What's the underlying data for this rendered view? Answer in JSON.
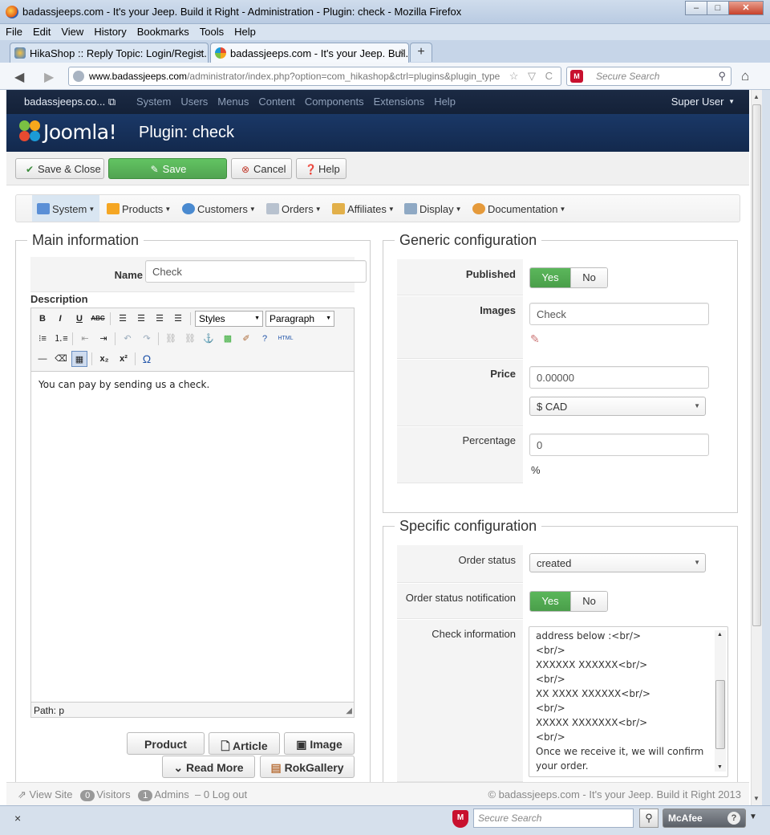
{
  "window": {
    "title": "badassjeeps.com - It's your Jeep. Build it Right - Administration - Plugin: check - Mozilla Firefox",
    "min": "‒",
    "max": "□",
    "close": "✕"
  },
  "browser_menu": [
    "File",
    "Edit",
    "View",
    "History",
    "Bookmarks",
    "Tools",
    "Help"
  ],
  "tabs": [
    {
      "label": "HikaShop :: Reply Topic: Login/Regist...",
      "close": "×"
    },
    {
      "label": "badassjeeps.com - It's your Jeep. Buil...",
      "close": "×"
    }
  ],
  "new_tab": "+",
  "urlbar": {
    "domain": "www.badassjeeps.com",
    "path": "/administrator/index.php?option=com_hikashop&ctrl=plugins&plugin_type",
    "icons": "☆ ▽ C"
  },
  "search": {
    "placeholder": "Secure Search"
  },
  "joomla": {
    "site": "badassjeeps.co...",
    "menu": [
      "System",
      "Users",
      "Menus",
      "Content",
      "Components",
      "Extensions",
      "Help"
    ],
    "user": "Super User",
    "brand": "Joomla!",
    "page_title": "Plugin: check"
  },
  "toolbar": {
    "save_close": "Save & Close",
    "save": "Save",
    "cancel": "Cancel",
    "help": "Help"
  },
  "hikamenu": [
    "System",
    "Products",
    "Customers",
    "Orders",
    "Affiliates",
    "Display",
    "Documentation"
  ],
  "main": {
    "legend": "Main information",
    "name_label": "Name",
    "name_value": "Check",
    "description_label": "Description",
    "editor": {
      "styles": "Styles",
      "format": "Paragraph",
      "content": "You can pay by sending us a check.",
      "path": "Path: p"
    },
    "buttons": {
      "product": "Product",
      "article": "Article",
      "image": "Image",
      "readmore": "Read More",
      "rokgallery": "RokGallery"
    }
  },
  "generic": {
    "legend": "Generic configuration",
    "published_label": "Published",
    "yes": "Yes",
    "no": "No",
    "images_label": "Images",
    "images_value": "Check",
    "price_label": "Price",
    "price_value": "0.00000",
    "currency": "$ CAD",
    "percentage_label": "Percentage",
    "percentage_value": "0",
    "percent_sign": "%"
  },
  "specific": {
    "legend": "Specific configuration",
    "order_status_label": "Order status",
    "order_status_value": "created",
    "notification_label": "Order status notification",
    "yes": "Yes",
    "no": "No",
    "check_info_label": "Check information",
    "check_info_lines": [
      "address below :<br/>",
      "<br/>",
      "XXXXXX XXXXXX<br/>",
      "<br/>",
      "XX XXXX XXXXXX<br/>",
      "<br/>",
      "XXXXX XXXXXXX<br/>",
      "<br/>",
      "Once we receive it, we will confirm",
      "your order."
    ]
  },
  "statusbar": {
    "view_site": "View Site",
    "visitors_count": "0",
    "visitors": "Visitors",
    "admins_count": "1",
    "admins": "Admins",
    "logout_count": "0",
    "logout": "Log out",
    "copyright": "© badassjeeps.com - It's your Jeep. Build it Right 2013"
  },
  "addonbar": {
    "close": "×",
    "search_placeholder": "Secure Search",
    "mcafee": "McAfee",
    "help": "?"
  },
  "colors": {
    "joomla_nav": "#1b2a44",
    "joomla_header": "#1a3867",
    "save_green": "#51a351",
    "yes_green": "#4a9e4a"
  }
}
